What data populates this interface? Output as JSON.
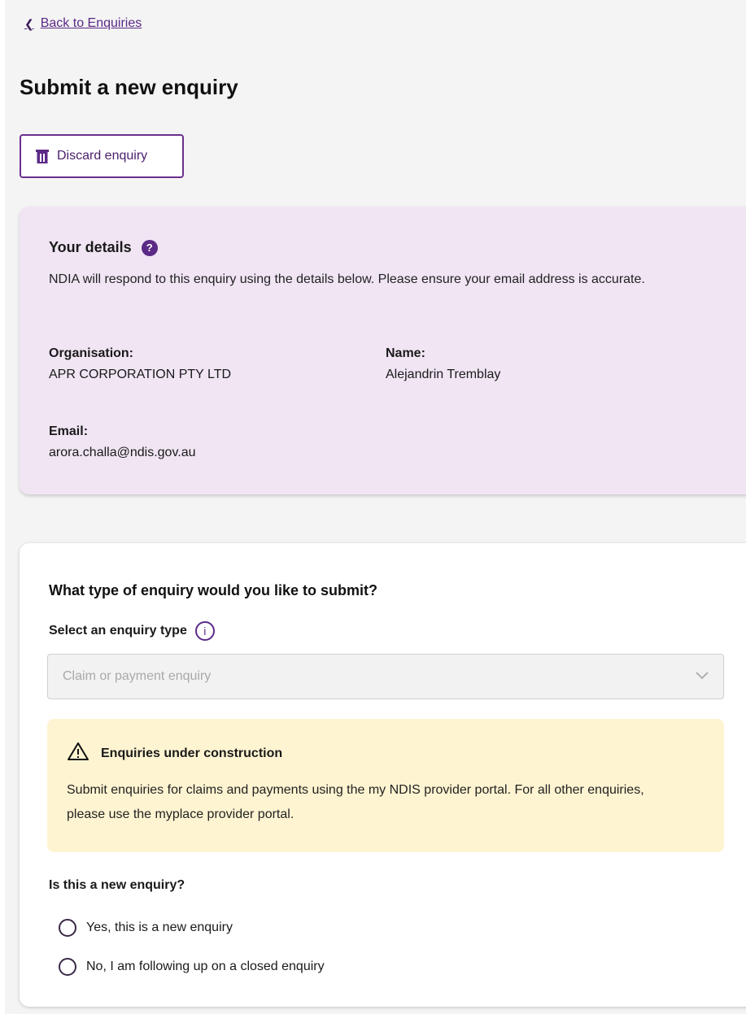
{
  "nav": {
    "back_label": "Back to Enquiries"
  },
  "page": {
    "title": "Submit a new enquiry"
  },
  "actions": {
    "discard_label": "Discard enquiry"
  },
  "details": {
    "heading": "Your details",
    "help_icon": "?",
    "intro": "NDIA will respond to this enquiry using the details below. Please ensure your email address is accurate.",
    "organisation_label": "Organisation:",
    "organisation_value": "APR CORPORATION PTY LTD",
    "name_label": "Name:",
    "name_value": "Alejandrin Tremblay",
    "email_label": "Email:",
    "email_value": "arora.challa@ndis.gov.au"
  },
  "enquiry": {
    "question": "What type of enquiry would you like to submit?",
    "select_label": "Select an enquiry type",
    "info_icon": "i",
    "select_placeholder": "Claim or payment enquiry",
    "warning_title": "Enquiries under construction",
    "warning_text": "Submit enquiries for claims and payments using the my NDIS provider portal. For all other enquiries, please use the myplace provider portal.",
    "new_question": "Is this a new enquiry?",
    "options": [
      {
        "label": "Yes, this is a new enquiry"
      },
      {
        "label": "No, I am following up on a closed enquiry"
      }
    ]
  },
  "colors": {
    "brand_purple": "#5b2a86",
    "details_bg": "#f1e5f4",
    "warning_bg": "#fff4d1"
  }
}
